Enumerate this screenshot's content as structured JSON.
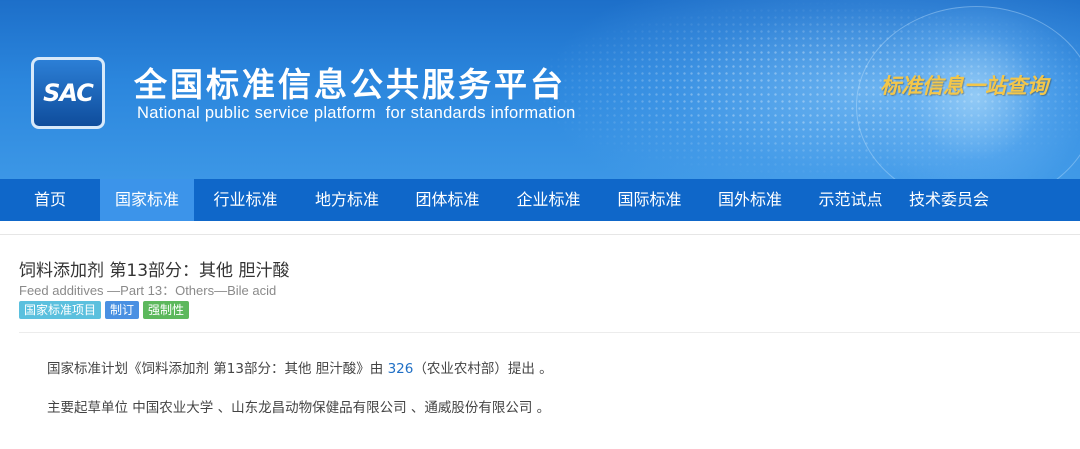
{
  "header": {
    "logo_text": "SAC",
    "title": "全国标准信息公共服务平台",
    "subtitle": "National public service platform  for standards information",
    "slogan": "标准信息一站查询"
  },
  "nav": {
    "items": [
      {
        "label": "首页",
        "active": false
      },
      {
        "label": "国家标准",
        "active": true
      },
      {
        "label": "行业标准",
        "active": false
      },
      {
        "label": "地方标准",
        "active": false
      },
      {
        "label": "团体标准",
        "active": false
      },
      {
        "label": "企业标准",
        "active": false
      },
      {
        "label": "国际标准",
        "active": false
      },
      {
        "label": "国外标准",
        "active": false
      },
      {
        "label": "示范试点",
        "active": false
      },
      {
        "label": "技术委员会",
        "active": false
      }
    ],
    "colors": {
      "bar": "#0f67c9",
      "active": "#3c94ea"
    }
  },
  "standard": {
    "title_cn": "饲料添加剂 第13部分：其他 胆汁酸",
    "title_en": "Feed additives —Part 13：Others—Bile acid",
    "tags": [
      {
        "label": "国家标准项目",
        "color": "#5bc0de"
      },
      {
        "label": "制订",
        "color": "#4a90e2"
      },
      {
        "label": "强制性",
        "color": "#5cb85c"
      }
    ],
    "plan": {
      "prefix": "国家标准计划《饲料添加剂 第13部分：其他 胆汁酸》由 ",
      "tc_code": "326",
      "suffix": "（农业农村部）提出 。"
    },
    "drafting": "主要起草单位 中国农业大学 、山东龙昌动物保健品有限公司 、通威股份有限公司 。"
  }
}
